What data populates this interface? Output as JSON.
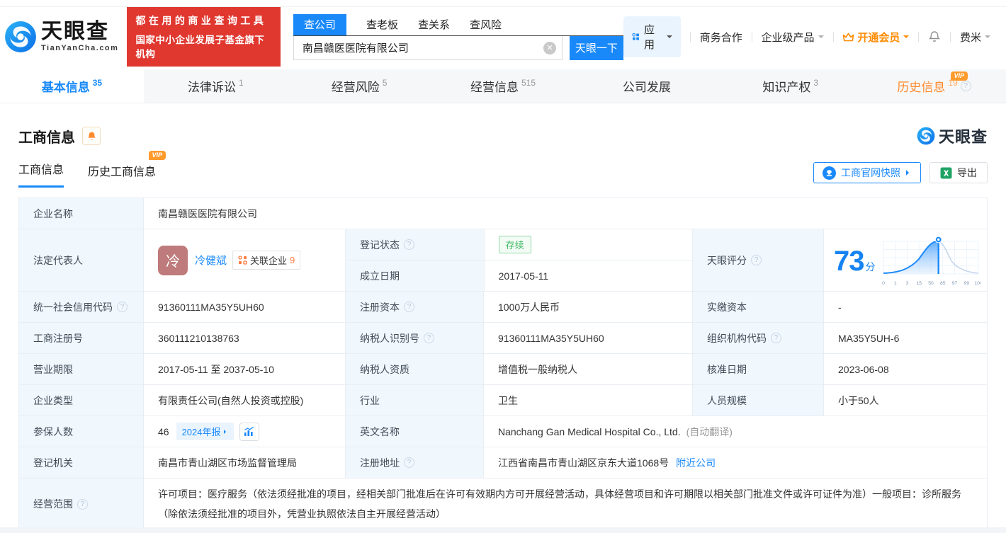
{
  "header": {
    "logo": {
      "brand": "天眼查",
      "domain": "TianYanCha.com"
    },
    "promo": {
      "line1": "都在用的商业查询工具",
      "line2": "国家中小企业发展子基金旗下机构"
    },
    "search": {
      "tabs": [
        {
          "label": "查公司"
        },
        {
          "label": "查老板"
        },
        {
          "label": "查关系"
        },
        {
          "label": "查风险"
        }
      ],
      "value": "南昌赣医医院有限公司",
      "button": "天眼一下"
    },
    "nav": {
      "apps": "应用",
      "cooperation": "商务合作",
      "enterprise": "企业级产品",
      "membership": "开通会员",
      "username": "费米"
    }
  },
  "main_tabs": [
    {
      "label": "基本信息",
      "count": "35"
    },
    {
      "label": "法律诉讼",
      "count": "1"
    },
    {
      "label": "经营风险",
      "count": "5"
    },
    {
      "label": "经营信息",
      "count": "515"
    },
    {
      "label": "公司发展",
      "count": ""
    },
    {
      "label": "知识产权",
      "count": "3"
    },
    {
      "label": "历史信息",
      "count": "19"
    }
  ],
  "section": {
    "title": "工商信息",
    "watermark_brand": "天眼查",
    "subtab_current": "工商信息",
    "subtab_history": "历史工商信息",
    "vip_badge": "VIP",
    "snapshot_button": "工商官网快照",
    "export_button": "导出"
  },
  "info": {
    "company_name": {
      "label": "企业名称",
      "value": "南昌赣医医院有限公司"
    },
    "legal_rep": {
      "label": "法定代表人",
      "avatar_char": "冷",
      "name": "冷健斌",
      "related_label": "关联企业",
      "related_count": "9"
    },
    "reg_status": {
      "label": "登记状态",
      "value": "存续"
    },
    "establish_date": {
      "label": "成立日期",
      "value": "2017-05-11"
    },
    "score": {
      "label": "天眼评分",
      "value": "73",
      "unit": "分"
    },
    "credit_code": {
      "label": "统一社会信用代码",
      "value": "91360111MA35Y5UH60"
    },
    "reg_capital": {
      "label": "注册资本",
      "value": "1000万人民币"
    },
    "paid_capital": {
      "label": "实缴资本",
      "value": "-"
    },
    "reg_number": {
      "label": "工商注册号",
      "value": "360111210138763"
    },
    "taxpayer_id": {
      "label": "纳税人识别号",
      "value": "91360111MA35Y5UH60"
    },
    "org_code": {
      "label": "组织机构代码",
      "value": "MA35Y5UH-6"
    },
    "business_term": {
      "label": "营业期限",
      "value": "2017-05-11 至 2037-05-10"
    },
    "taxpayer_quality": {
      "label": "纳税人资质",
      "value": "增值税一般纳税人"
    },
    "approval_date": {
      "label": "核准日期",
      "value": "2023-06-08"
    },
    "company_type": {
      "label": "企业类型",
      "value": "有限责任公司(自然人投资或控股)"
    },
    "industry": {
      "label": "行业",
      "value": "卫生"
    },
    "staff_size": {
      "label": "人员规模",
      "value": "小于50人"
    },
    "insured": {
      "label": "参保人数",
      "value": "46",
      "report_badge": "2024年报"
    },
    "english_name": {
      "label": "英文名称",
      "value": "Nanchang Gan Medical Hospital Co., Ltd.",
      "note": "(自动翻译)"
    },
    "reg_authority": {
      "label": "登记机关",
      "value": "南昌市青山湖区市场监督管理局"
    },
    "reg_address": {
      "label": "注册地址",
      "value": "江西省南昌市青山湖区京东大道1068号",
      "nearby_link": "附近公司"
    },
    "business_scope": {
      "label": "经营范围",
      "value": "许可项目：医疗服务（依法须经批准的项目，经相关部门批准后在许可有效期内方可开展经营活动，具体经营项目和许可期限以相关部门批准文件或许可证件为准）一般项目：诊所服务（除依法须经批准的项目外，凭营业执照依法自主开展经营活动）"
    }
  },
  "chart_data": {
    "type": "area",
    "title": "天眼评分",
    "score": 73,
    "x_ticks": [
      "0",
      "1",
      "3",
      "15",
      "50",
      "85",
      "97",
      "99",
      "100"
    ],
    "marker_fraction": 0.58,
    "accent_color": "#1989fa",
    "grid": true
  },
  "colors": {
    "accent": "#1989fa",
    "orange": "#ff8a2b",
    "green": "#3bb861",
    "red": "#e0372f"
  }
}
